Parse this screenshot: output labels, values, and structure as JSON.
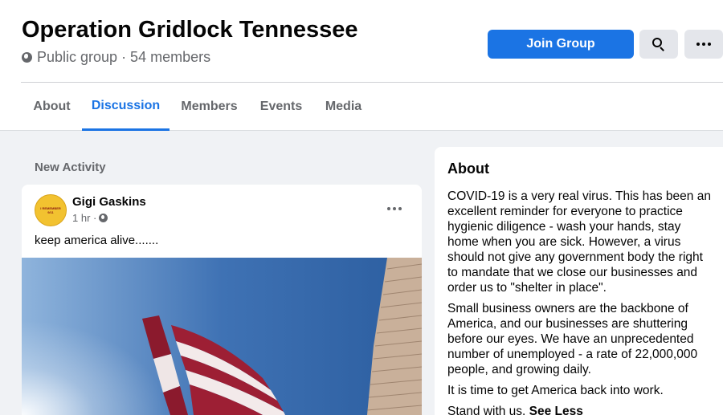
{
  "group": {
    "title": "Operation Gridlock Tennessee",
    "meta": "Public group · 54 members",
    "join_label": "Join Group"
  },
  "icons": {
    "privacy": "globe-icon",
    "search": "search-icon",
    "more": "more-horizontal-icon"
  },
  "tabs": [
    {
      "label": "About",
      "active": false
    },
    {
      "label": "Discussion",
      "active": true
    },
    {
      "label": "Members",
      "active": false
    },
    {
      "label": "Events",
      "active": false
    },
    {
      "label": "Media",
      "active": false
    }
  ],
  "feed": {
    "section_label": "New Activity",
    "post": {
      "author": "Gigi Gaskins",
      "avatar_text_1": "I REMEMBER",
      "avatar_text_2": "9/11",
      "time": "1 hr ·",
      "text": "keep america alive.......",
      "image": "american-flag-photo"
    }
  },
  "about": {
    "title": "About",
    "paragraphs": [
      "COVID-19 is a very real virus. This has been an excellent reminder for everyone to practice hygienic diligence - wash your hands, stay home when you are sick. However, a virus should not give any government body the right to mandate that we close our businesses and order us to \"shelter in place\".",
      "Small business owners are the backbone of America, and our businesses are shuttering before our eyes. We have an unprecedented number of unemployed - a rate of 22,000,000 people, and growing daily.",
      "It is time to get America back into work."
    ],
    "last_line": "Stand with us.",
    "see_less": "See Less"
  },
  "colors": {
    "accent": "#1b74e4",
    "background": "#f0f2f5",
    "secondary_text": "#65676b"
  }
}
